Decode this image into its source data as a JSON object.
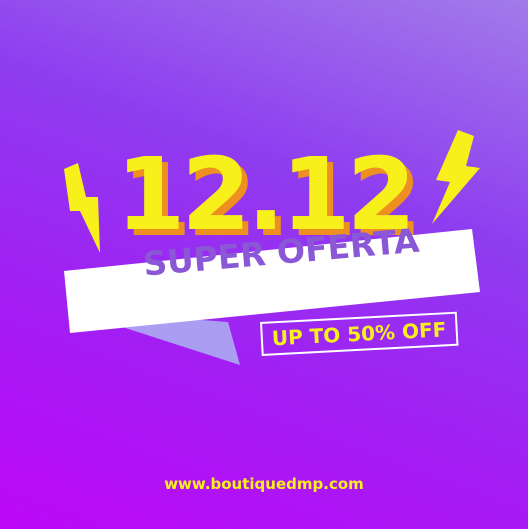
{
  "headline": "12.12",
  "banner": {
    "text": "SUPER OFERTA"
  },
  "offer": {
    "text": "UP TO 50% OFF"
  },
  "website": "www.boutiquedmp.com",
  "colors": {
    "accent_yellow": "#f7f01b",
    "shadow_orange": "#ee8f22",
    "banner_text_purple": "#8a58d6",
    "ribbon_lavender": "#ab9ef2"
  },
  "icons": [
    "lightning-bolt-icon",
    "lightning-bolt-icon"
  ]
}
